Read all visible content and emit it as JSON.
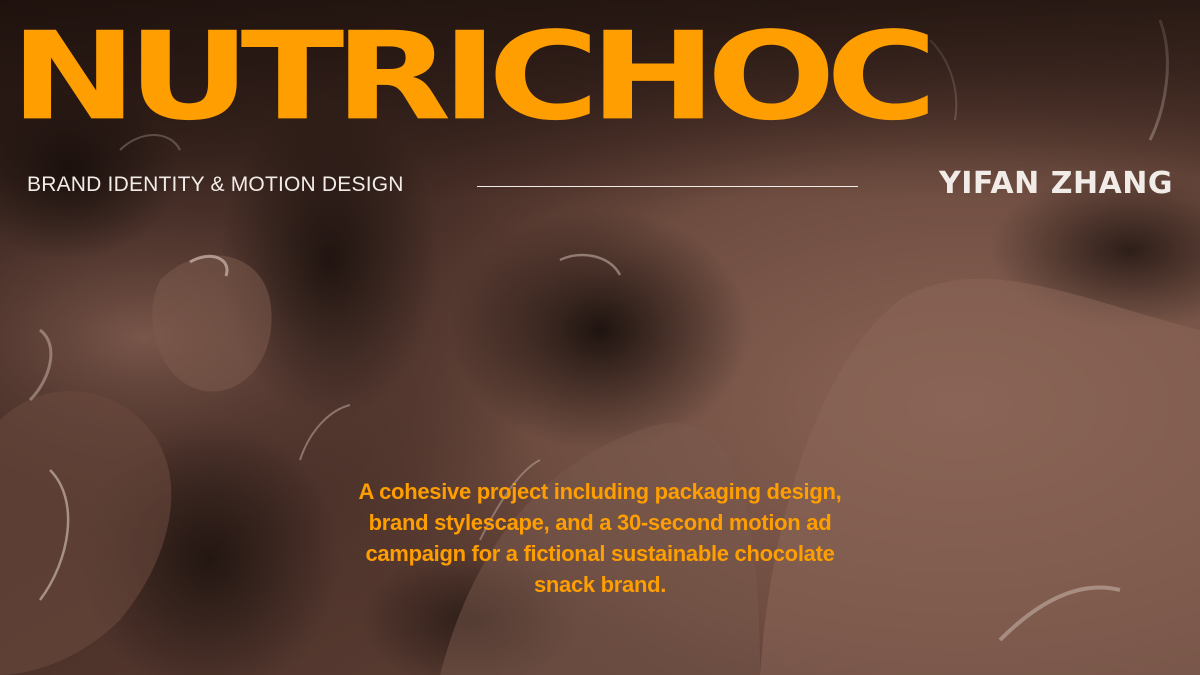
{
  "hero": {
    "title": "NUTRICHOC",
    "subtitle": "BRAND IDENTITY & MOTION DESIGN",
    "author": "YIFAN ZHANG",
    "description": "A cohesive project including packaging design, brand stylescape, and a 30-second motion ad campaign for a fictional sustainable chocolate snack brand."
  },
  "colors": {
    "accent": "#FF9E00",
    "text_light": "#F2ECE8",
    "chocolate_dark": "#2A1A15",
    "chocolate_mid": "#5A3A30",
    "chocolate_light": "#8A6658"
  }
}
